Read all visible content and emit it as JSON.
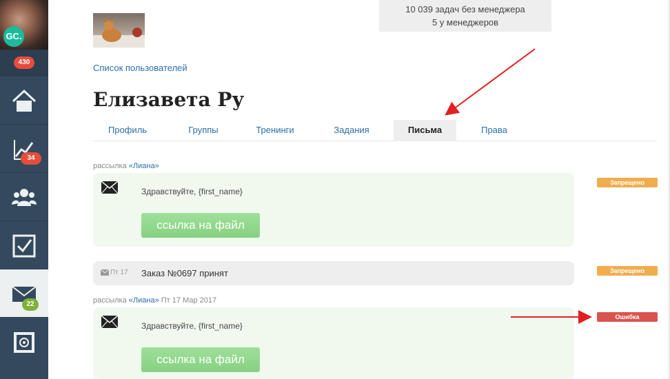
{
  "sidebar": {
    "logo": "GC.",
    "notifications_count": "430",
    "items": [
      {
        "icon": "home-icon"
      },
      {
        "icon": "chart-icon",
        "badge": "34"
      },
      {
        "icon": "users-icon"
      },
      {
        "icon": "checkbox-icon"
      },
      {
        "icon": "mail-icon",
        "badge": "22",
        "active": true
      },
      {
        "icon": "safe-icon"
      }
    ]
  },
  "stats": {
    "line1": "10 039 задач без менеджера",
    "line2": "5 у менеджеров"
  },
  "header": {
    "user_list_link": "Список пользователей",
    "title": "Елизавета Ру"
  },
  "tabs": [
    {
      "label": "Профиль"
    },
    {
      "label": "Группы"
    },
    {
      "label": "Тренинги"
    },
    {
      "label": "Задания"
    },
    {
      "label": "Письма",
      "active": true
    },
    {
      "label": "Права"
    }
  ],
  "messages": [
    {
      "meta_prefix": "рассылка ",
      "sender": "«Лиана»",
      "meta_date": "",
      "greeting": "Здравствуйте, {first_name}",
      "button": "ссылка на файл",
      "status": "Запрещено"
    },
    {
      "date": "Пт 17",
      "subject": "Заказ №0697 принят",
      "status": "Запрещено"
    },
    {
      "meta_prefix": "рассылка ",
      "sender": "«Лиана»",
      "meta_date": " Пт 17 Мар 2017",
      "greeting": "Здравствуйте, {first_name}",
      "button": "ссылка на файл",
      "status": "Ошибка"
    }
  ],
  "colors": {
    "sidebar": "#34495e",
    "link": "#2a6fa8",
    "forbidden": "#f0ad4e",
    "error": "#d9534f",
    "annotation_arrow": "#e02020"
  }
}
